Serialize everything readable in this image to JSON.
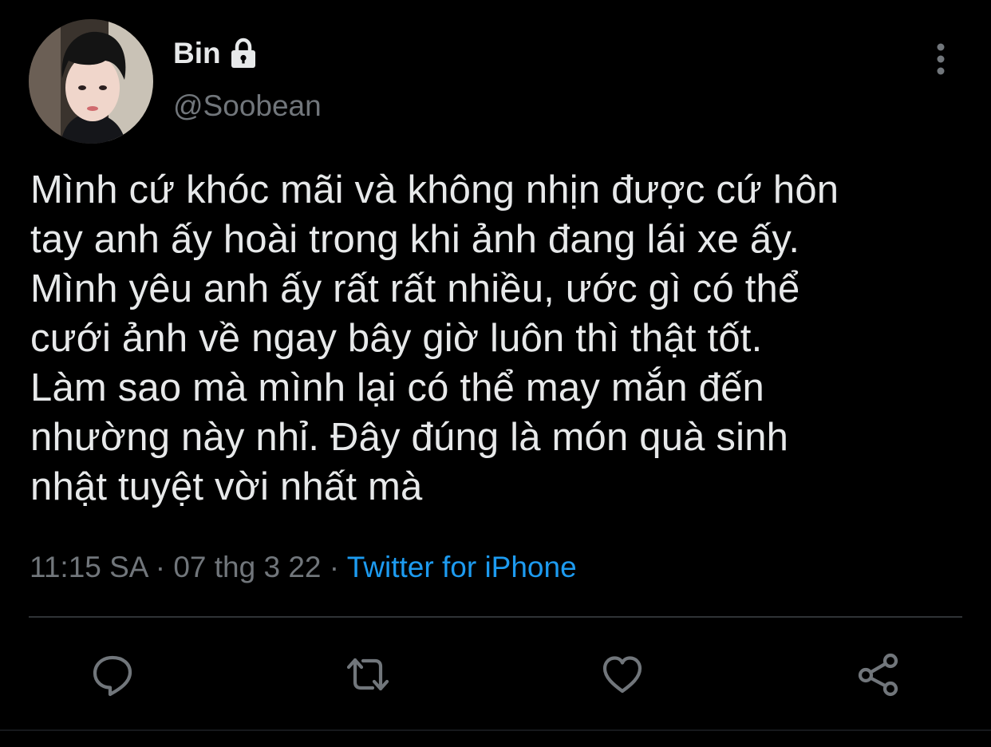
{
  "user": {
    "display_name": "Bin",
    "handle": "@Soobean",
    "protected_icon": "lock-icon"
  },
  "tweet": {
    "text": "Mình cứ khóc mãi và không nhịn được cứ hôn\ntay anh ấy hoài trong khi ảnh đang lái xe ấy.\nMình yêu anh ấy rất rất nhiều, ước gì có thể\ncưới ảnh về ngay bây giờ luôn thì thật tốt.\nLàm sao mà mình lại có thể may mắn đến\nnhường này nhỉ. Đây đúng là món quà sinh\nnhật tuyệt vời nhất mà",
    "time": "11:15 SA",
    "separator": "·",
    "date": "07 thg 3 22",
    "source": "Twitter for iPhone"
  },
  "actions": [
    {
      "icon": "reply-icon"
    },
    {
      "icon": "retweet-icon"
    },
    {
      "icon": "like-icon"
    },
    {
      "icon": "share-icon"
    }
  ],
  "colors": {
    "background": "#000000",
    "text": "#e7e9ea",
    "secondary": "#71767b",
    "link": "#1d9bf0",
    "divider": "#2f3336"
  }
}
